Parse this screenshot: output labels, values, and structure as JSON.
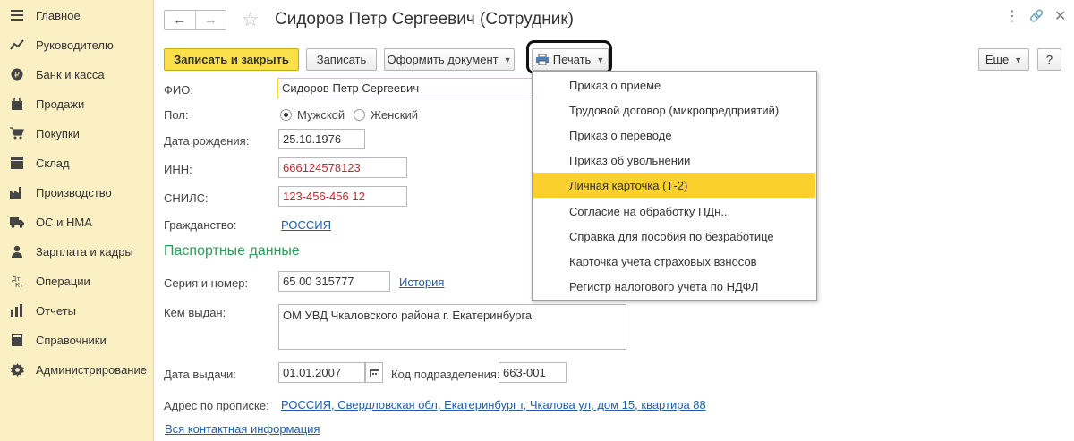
{
  "sidebar": {
    "items": [
      {
        "label": "Главное",
        "icon": "hamburger-icon"
      },
      {
        "label": "Руководителю",
        "icon": "chart-line-icon"
      },
      {
        "label": "Банк и касса",
        "icon": "coin-icon"
      },
      {
        "label": "Продажи",
        "icon": "bag-icon"
      },
      {
        "label": "Покупки",
        "icon": "cart-icon"
      },
      {
        "label": "Склад",
        "icon": "warehouse-icon"
      },
      {
        "label": "Производство",
        "icon": "factory-icon"
      },
      {
        "label": "ОС и НМА",
        "icon": "truck-icon"
      },
      {
        "label": "Зарплата и кадры",
        "icon": "people-icon"
      },
      {
        "label": "Операции",
        "icon": "operations-icon"
      },
      {
        "label": "Отчеты",
        "icon": "bar-chart-icon"
      },
      {
        "label": "Справочники",
        "icon": "book-icon"
      },
      {
        "label": "Администрирование",
        "icon": "gear-icon"
      }
    ]
  },
  "header": {
    "title": "Сидоров Петр Сергеевич (Сотрудник)",
    "back_icon": "←",
    "forward_icon": "→",
    "star_icon": "☆",
    "more_icon": "⋮",
    "link_icon": "🔗",
    "close_icon": "✕"
  },
  "toolbar": {
    "save_close": "Записать и закрыть",
    "save": "Записать",
    "create_doc": "Оформить документ",
    "print": "Печать",
    "more": "Еще",
    "help": "?"
  },
  "form": {
    "fio_label": "ФИО:",
    "fio_value": "Сидоров Петр Сергеевич",
    "sex_label": "Пол:",
    "sex_male": "Мужской",
    "sex_female": "Женский",
    "birth_label": "Дата рождения:",
    "birth_value": "25.10.1976",
    "inn_label": "ИНН:",
    "inn_value": "666124578123",
    "snils_label": "СНИЛС:",
    "snils_value": "123-456-456 12",
    "citizenship_label": "Гражданство:",
    "citizenship_value": "РОССИЯ",
    "passport_section": "Паспортные данные",
    "series_label": "Серия и номер:",
    "series_value": "65 00 315777",
    "history_link": "История",
    "issued_by_label": "Кем выдан:",
    "issued_by_value": "ОМ УВД Чкаловского района г. Екатеринбурга",
    "issue_date_label": "Дата выдачи:",
    "issue_date_value": "01.01.2007",
    "dept_code_label": "Код подразделения:",
    "dept_code_value": "663-001",
    "address_label": "Адрес по прописке:",
    "address_value": "РОССИЯ, Свердловская обл, Екатеринбург г, Чкалова ул, дом 15, квартира 88",
    "contacts_link": "Вся контактная информация"
  },
  "print_menu": {
    "items": [
      "Приказ о приеме",
      "Трудовой договор (микропредприятий)",
      "Приказ о переводе",
      "Приказ об увольнении",
      "Личная карточка (Т-2)",
      "Согласие на обработку ПДн...",
      "Справка для пособия по безработице",
      "Карточка учета страховых взносов",
      "Регистр налогового учета по НДФЛ"
    ],
    "selected": "Личная карточка (Т-2)"
  },
  "colors": {
    "sidebar_bg": "#fbf0c4",
    "primary_button": "#fbe04b",
    "selected_item": "#fad02d",
    "section_green": "#2c9c58",
    "link_blue": "#1f5ea8",
    "error_red": "#c4252c"
  }
}
